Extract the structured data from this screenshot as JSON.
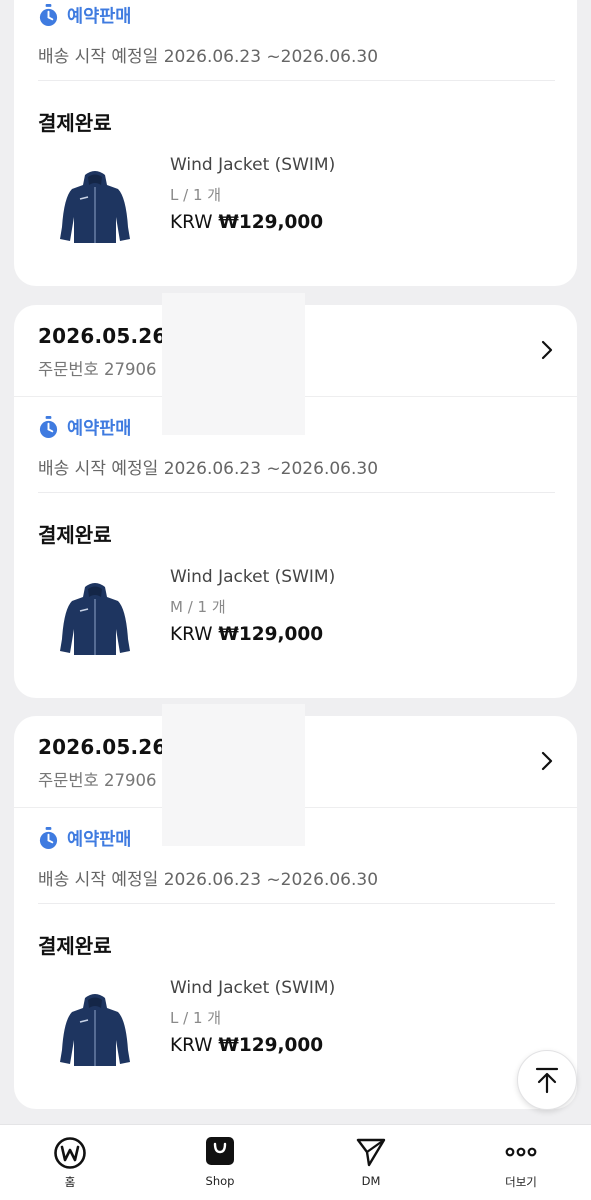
{
  "orders": [
    {
      "sale_label": "예약판매",
      "ship_text": "배송 시작 예정일 2026.06.23 ~2026.06.30",
      "status": "결제완료",
      "product": {
        "name": "Wind Jacket (SWIM)",
        "option": "L / 1 개",
        "currency": "KRW",
        "price": "₩129,000"
      }
    },
    {
      "date": "2026.05.26",
      "order_no": "주문번호 27906",
      "sale_label": "예약판매",
      "ship_text": "배송 시작 예정일 2026.06.23 ~2026.06.30",
      "status": "결제완료",
      "product": {
        "name": "Wind Jacket (SWIM)",
        "option": "M / 1 개",
        "currency": "KRW",
        "price": "₩129,000"
      }
    },
    {
      "date": "2026.05.26",
      "order_no": "주문번호 27906",
      "sale_label": "예약판매",
      "ship_text": "배송 시작 예정일 2026.06.23 ~2026.06.30",
      "status": "결제완료",
      "product": {
        "name": "Wind Jacket (SWIM)",
        "option": "L / 1 개",
        "currency": "KRW",
        "price": "₩129,000"
      }
    }
  ],
  "nav": {
    "items": [
      {
        "label": "홈",
        "icon": "home-w-icon"
      },
      {
        "label": "Shop",
        "icon": "shopping-bag-icon"
      },
      {
        "label": "DM",
        "icon": "paper-plane-icon"
      },
      {
        "label": "더보기",
        "icon": "more-dots-icon"
      }
    ]
  },
  "colors": {
    "accent": "#3f7be0",
    "background": "#efeff1",
    "card": "#ffffff"
  }
}
